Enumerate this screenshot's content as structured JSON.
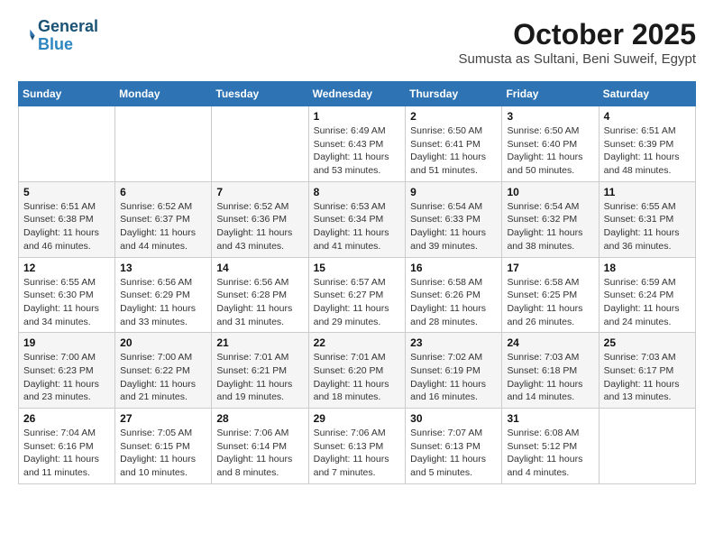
{
  "logo": {
    "line1": "General",
    "line2": "Blue"
  },
  "title": "October 2025",
  "location": "Sumusta as Sultani, Beni Suweif, Egypt",
  "weekdays": [
    "Sunday",
    "Monday",
    "Tuesday",
    "Wednesday",
    "Thursday",
    "Friday",
    "Saturday"
  ],
  "weeks": [
    [
      {
        "day": "",
        "info": ""
      },
      {
        "day": "",
        "info": ""
      },
      {
        "day": "",
        "info": ""
      },
      {
        "day": "1",
        "info": "Sunrise: 6:49 AM\nSunset: 6:43 PM\nDaylight: 11 hours\nand 53 minutes."
      },
      {
        "day": "2",
        "info": "Sunrise: 6:50 AM\nSunset: 6:41 PM\nDaylight: 11 hours\nand 51 minutes."
      },
      {
        "day": "3",
        "info": "Sunrise: 6:50 AM\nSunset: 6:40 PM\nDaylight: 11 hours\nand 50 minutes."
      },
      {
        "day": "4",
        "info": "Sunrise: 6:51 AM\nSunset: 6:39 PM\nDaylight: 11 hours\nand 48 minutes."
      }
    ],
    [
      {
        "day": "5",
        "info": "Sunrise: 6:51 AM\nSunset: 6:38 PM\nDaylight: 11 hours\nand 46 minutes."
      },
      {
        "day": "6",
        "info": "Sunrise: 6:52 AM\nSunset: 6:37 PM\nDaylight: 11 hours\nand 44 minutes."
      },
      {
        "day": "7",
        "info": "Sunrise: 6:52 AM\nSunset: 6:36 PM\nDaylight: 11 hours\nand 43 minutes."
      },
      {
        "day": "8",
        "info": "Sunrise: 6:53 AM\nSunset: 6:34 PM\nDaylight: 11 hours\nand 41 minutes."
      },
      {
        "day": "9",
        "info": "Sunrise: 6:54 AM\nSunset: 6:33 PM\nDaylight: 11 hours\nand 39 minutes."
      },
      {
        "day": "10",
        "info": "Sunrise: 6:54 AM\nSunset: 6:32 PM\nDaylight: 11 hours\nand 38 minutes."
      },
      {
        "day": "11",
        "info": "Sunrise: 6:55 AM\nSunset: 6:31 PM\nDaylight: 11 hours\nand 36 minutes."
      }
    ],
    [
      {
        "day": "12",
        "info": "Sunrise: 6:55 AM\nSunset: 6:30 PM\nDaylight: 11 hours\nand 34 minutes."
      },
      {
        "day": "13",
        "info": "Sunrise: 6:56 AM\nSunset: 6:29 PM\nDaylight: 11 hours\nand 33 minutes."
      },
      {
        "day": "14",
        "info": "Sunrise: 6:56 AM\nSunset: 6:28 PM\nDaylight: 11 hours\nand 31 minutes."
      },
      {
        "day": "15",
        "info": "Sunrise: 6:57 AM\nSunset: 6:27 PM\nDaylight: 11 hours\nand 29 minutes."
      },
      {
        "day": "16",
        "info": "Sunrise: 6:58 AM\nSunset: 6:26 PM\nDaylight: 11 hours\nand 28 minutes."
      },
      {
        "day": "17",
        "info": "Sunrise: 6:58 AM\nSunset: 6:25 PM\nDaylight: 11 hours\nand 26 minutes."
      },
      {
        "day": "18",
        "info": "Sunrise: 6:59 AM\nSunset: 6:24 PM\nDaylight: 11 hours\nand 24 minutes."
      }
    ],
    [
      {
        "day": "19",
        "info": "Sunrise: 7:00 AM\nSunset: 6:23 PM\nDaylight: 11 hours\nand 23 minutes."
      },
      {
        "day": "20",
        "info": "Sunrise: 7:00 AM\nSunset: 6:22 PM\nDaylight: 11 hours\nand 21 minutes."
      },
      {
        "day": "21",
        "info": "Sunrise: 7:01 AM\nSunset: 6:21 PM\nDaylight: 11 hours\nand 19 minutes."
      },
      {
        "day": "22",
        "info": "Sunrise: 7:01 AM\nSunset: 6:20 PM\nDaylight: 11 hours\nand 18 minutes."
      },
      {
        "day": "23",
        "info": "Sunrise: 7:02 AM\nSunset: 6:19 PM\nDaylight: 11 hours\nand 16 minutes."
      },
      {
        "day": "24",
        "info": "Sunrise: 7:03 AM\nSunset: 6:18 PM\nDaylight: 11 hours\nand 14 minutes."
      },
      {
        "day": "25",
        "info": "Sunrise: 7:03 AM\nSunset: 6:17 PM\nDaylight: 11 hours\nand 13 minutes."
      }
    ],
    [
      {
        "day": "26",
        "info": "Sunrise: 7:04 AM\nSunset: 6:16 PM\nDaylight: 11 hours\nand 11 minutes."
      },
      {
        "day": "27",
        "info": "Sunrise: 7:05 AM\nSunset: 6:15 PM\nDaylight: 11 hours\nand 10 minutes."
      },
      {
        "day": "28",
        "info": "Sunrise: 7:06 AM\nSunset: 6:14 PM\nDaylight: 11 hours\nand 8 minutes."
      },
      {
        "day": "29",
        "info": "Sunrise: 7:06 AM\nSunset: 6:13 PM\nDaylight: 11 hours\nand 7 minutes."
      },
      {
        "day": "30",
        "info": "Sunrise: 7:07 AM\nSunset: 6:13 PM\nDaylight: 11 hours\nand 5 minutes."
      },
      {
        "day": "31",
        "info": "Sunrise: 6:08 AM\nSunset: 5:12 PM\nDaylight: 11 hours\nand 4 minutes."
      },
      {
        "day": "",
        "info": ""
      }
    ]
  ]
}
